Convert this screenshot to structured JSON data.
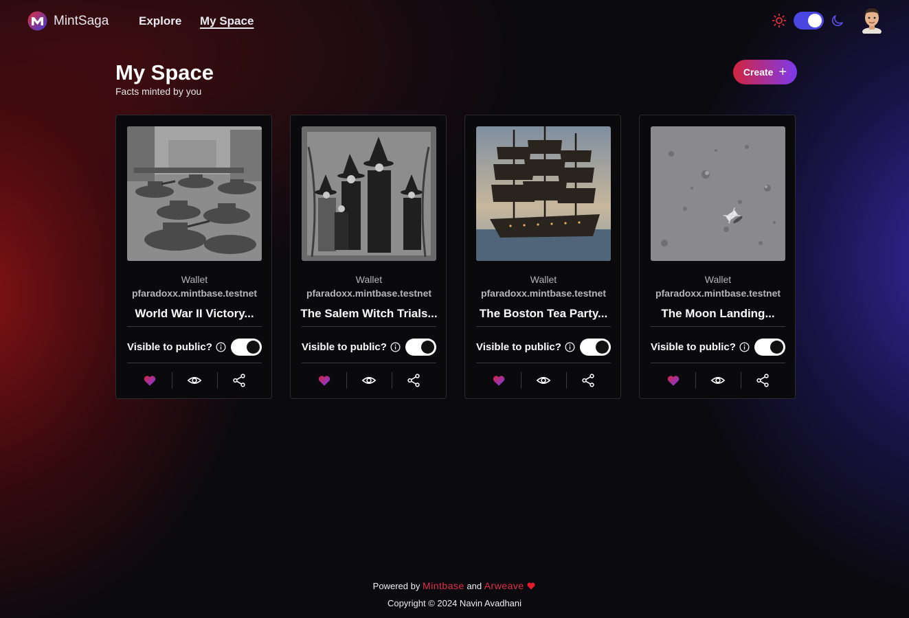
{
  "nav": {
    "brand": "MintSaga",
    "links": [
      "Explore",
      "My Space"
    ],
    "active_link": "My Space",
    "theme_toggle": "dark",
    "icons": [
      "sun-icon",
      "moon-icon"
    ]
  },
  "header": {
    "title": "My Space",
    "subtitle": "Facts minted by you",
    "create_label": "Create"
  },
  "cards": [
    {
      "wallet_label": "Wallet",
      "wallet": "pfaradoxx.mintbase.testnet",
      "title": "World War II Victory...",
      "visibility_label": "Visible to public?",
      "visible": true,
      "image": "tanks in city square"
    },
    {
      "wallet_label": "Wallet",
      "wallet": "pfaradoxx.mintbase.testnet",
      "title": "The Salem Witch Trials...",
      "visibility_label": "Visible to public?",
      "visible": true,
      "image": "women in witch hats"
    },
    {
      "wallet_label": "Wallet",
      "wallet": "pfaradoxx.mintbase.testnet",
      "title": "The Boston Tea Party...",
      "visibility_label": "Visible to public?",
      "visible": true,
      "image": "sailing ship at sea"
    },
    {
      "wallet_label": "Wallet",
      "wallet": "pfaradoxx.mintbase.testnet",
      "title": "The Moon Landing...",
      "visibility_label": "Visible to public?",
      "visible": true,
      "image": "lunar surface"
    }
  ],
  "footer": {
    "powered_prefix": "Powered by",
    "mintbase": "Mintbase",
    "and": "and",
    "arweave": "Arweave",
    "copyright": "Copyright © 2024 Navin Avadhani"
  },
  "colors": {
    "accent_red": "#d2253d",
    "accent_purple": "#7c3aed",
    "toggle_blue": "#4a46e0"
  }
}
